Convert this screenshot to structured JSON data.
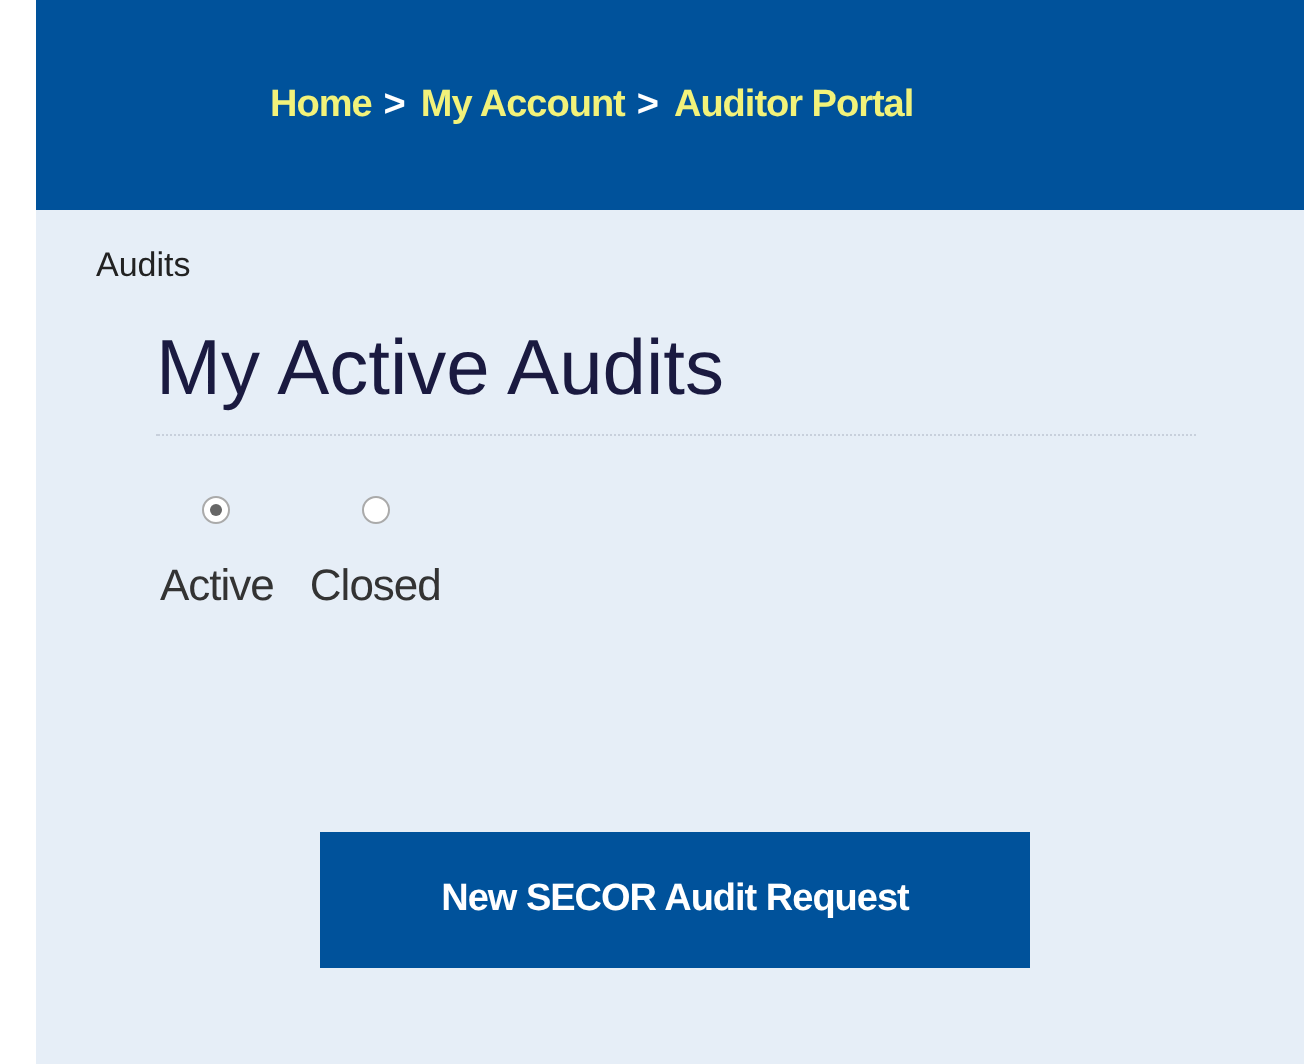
{
  "breadcrumb": [
    {
      "label": "Home",
      "separator": ">"
    },
    {
      "label": "My Account",
      "separator": ">"
    },
    {
      "label": "Auditor Portal"
    }
  ],
  "section_label": "Audits",
  "heading": "My Active Audits",
  "filters": [
    {
      "label": "Active",
      "selected": true
    },
    {
      "label": "Closed",
      "selected": false
    }
  ],
  "button": "New SECOR Audit Request"
}
